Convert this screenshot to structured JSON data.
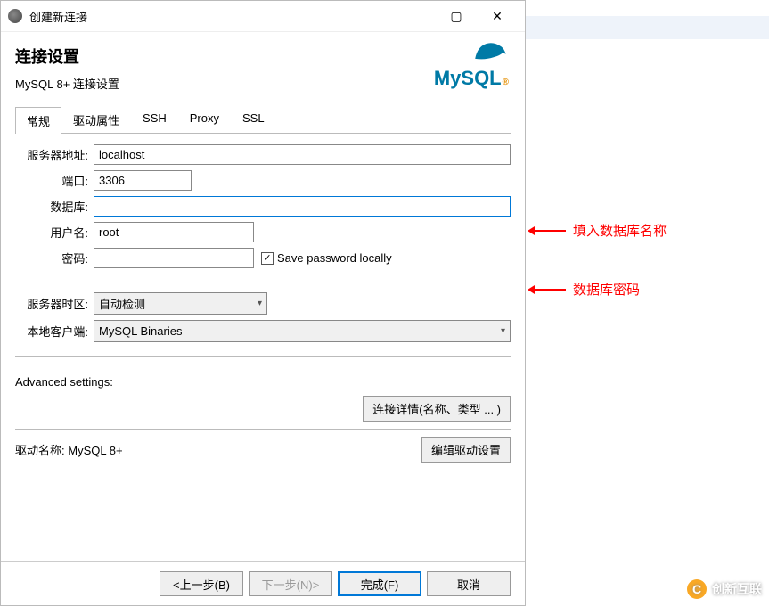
{
  "window": {
    "title": "创建新连接",
    "header": "连接设置",
    "subtitle": "MySQL 8+ 连接设置",
    "logo_text": "MySQL",
    "logo_reg": "®"
  },
  "tabs": {
    "general": "常规",
    "driver": "驱动属性",
    "ssh": "SSH",
    "proxy": "Proxy",
    "ssl": "SSL"
  },
  "form": {
    "server_label": "服务器地址:",
    "server_value": "localhost",
    "port_label": "端口:",
    "port_value": "3306",
    "database_label": "数据库:",
    "database_value": "",
    "username_label": "用户名:",
    "username_value": "root",
    "password_label": "密码:",
    "password_value": "",
    "save_password_label": "Save password locally",
    "timezone_label": "服务器时区:",
    "timezone_value": "自动检测",
    "client_label": "本地客户端:",
    "client_value": "MySQL Binaries",
    "advanced_label": "Advanced settings:",
    "details_button": "连接详情(名称、类型 ... )",
    "driver_name_label": "驱动名称:",
    "driver_name_value": "MySQL 8+",
    "edit_driver_button": "编辑驱动设置"
  },
  "footer": {
    "back": "<上一步(B)",
    "next": "下一步(N)>",
    "finish": "完成(F)",
    "cancel": "取消"
  },
  "annotations": {
    "db_name": "填入数据库名称",
    "db_password": "数据库密码"
  },
  "watermark": "创新互联"
}
